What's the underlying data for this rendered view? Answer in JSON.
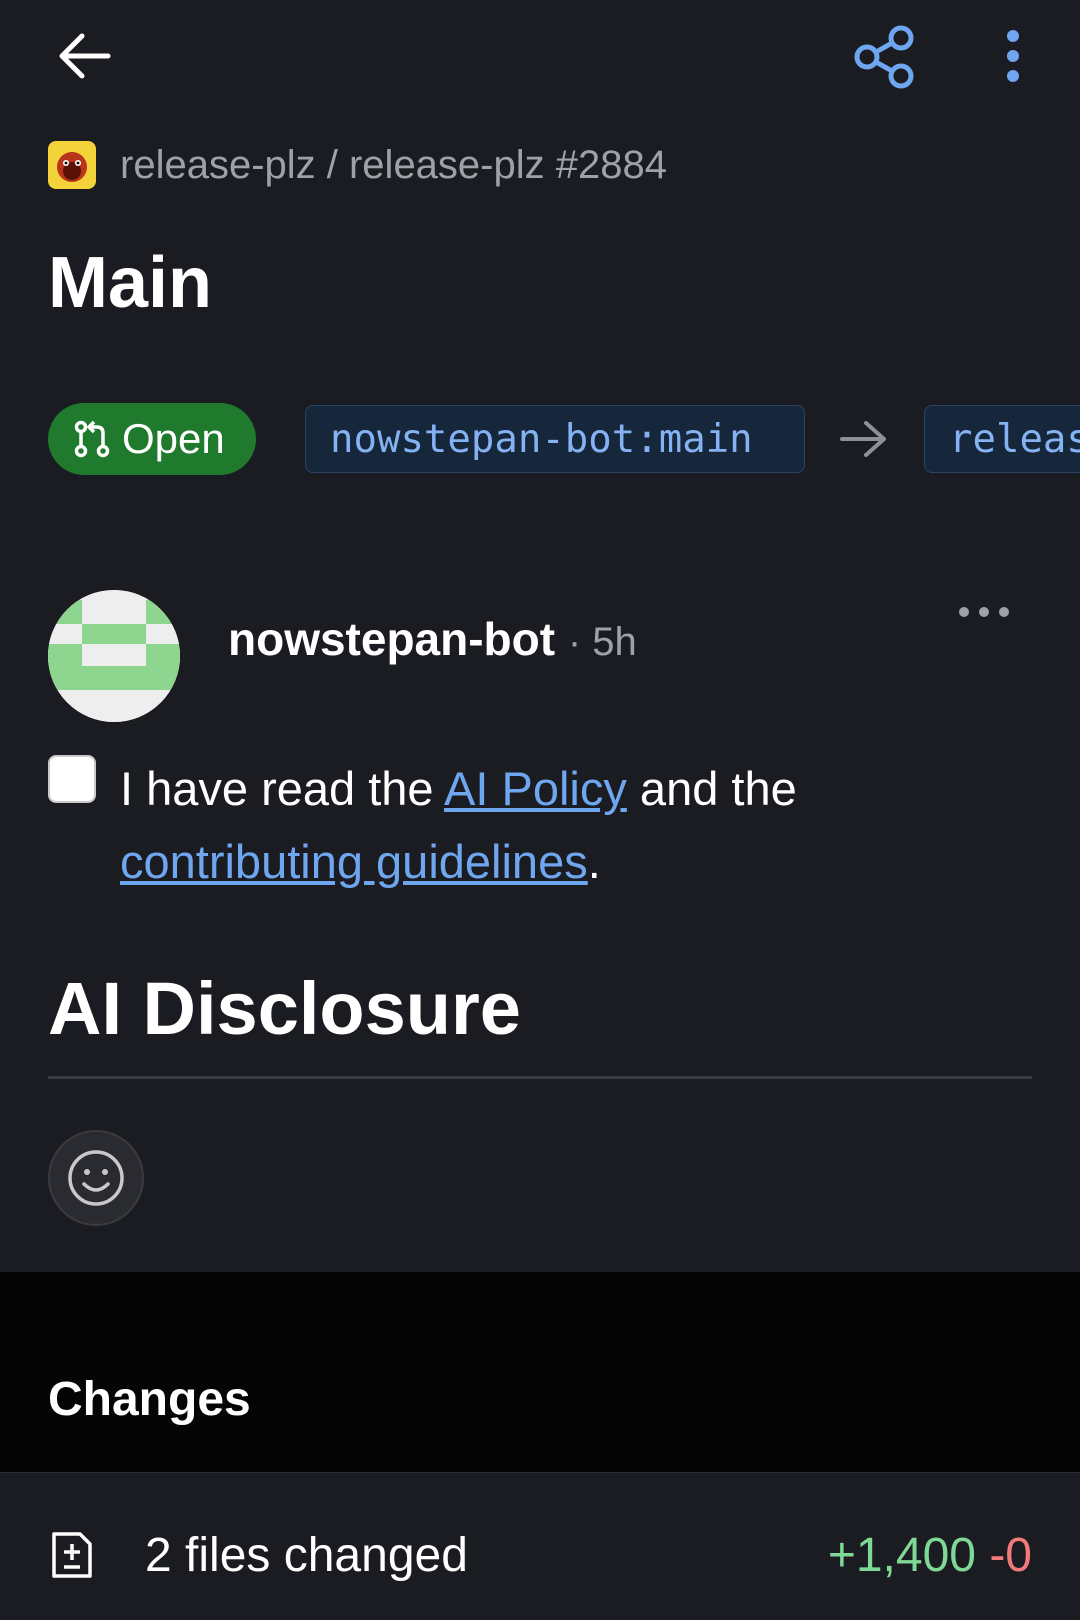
{
  "appbar": {
    "back_icon": "arrow-left-icon",
    "share_icon": "share-icon",
    "more_icon": "more-vertical-icon",
    "icon_color": "#6ea6f0"
  },
  "breadcrumb": {
    "text": "release-plz / release-plz #2884",
    "repo_icon": "repo-owner-avatar"
  },
  "pr": {
    "title": "Main",
    "state": "Open",
    "state_color": "#1f7a2d",
    "head_branch": "nowstepan-bot:main",
    "base_branch": "release-plz:main"
  },
  "comment": {
    "author": "nowstepan-bot",
    "time": "· 5h",
    "checkbox_checked": false,
    "text_prefix": "I have read the ",
    "link_ai_policy": "AI Policy",
    "text_mid": " and the ",
    "link_guidelines": "contributing guidelines",
    "text_suffix": ".",
    "heading": "AI Disclosure"
  },
  "changes": {
    "title": "Changes",
    "files_label": "2 files changed",
    "additions": "+1,400",
    "deletions": "-0",
    "add_color": "#7ed896",
    "del_color": "#f47a7a"
  }
}
